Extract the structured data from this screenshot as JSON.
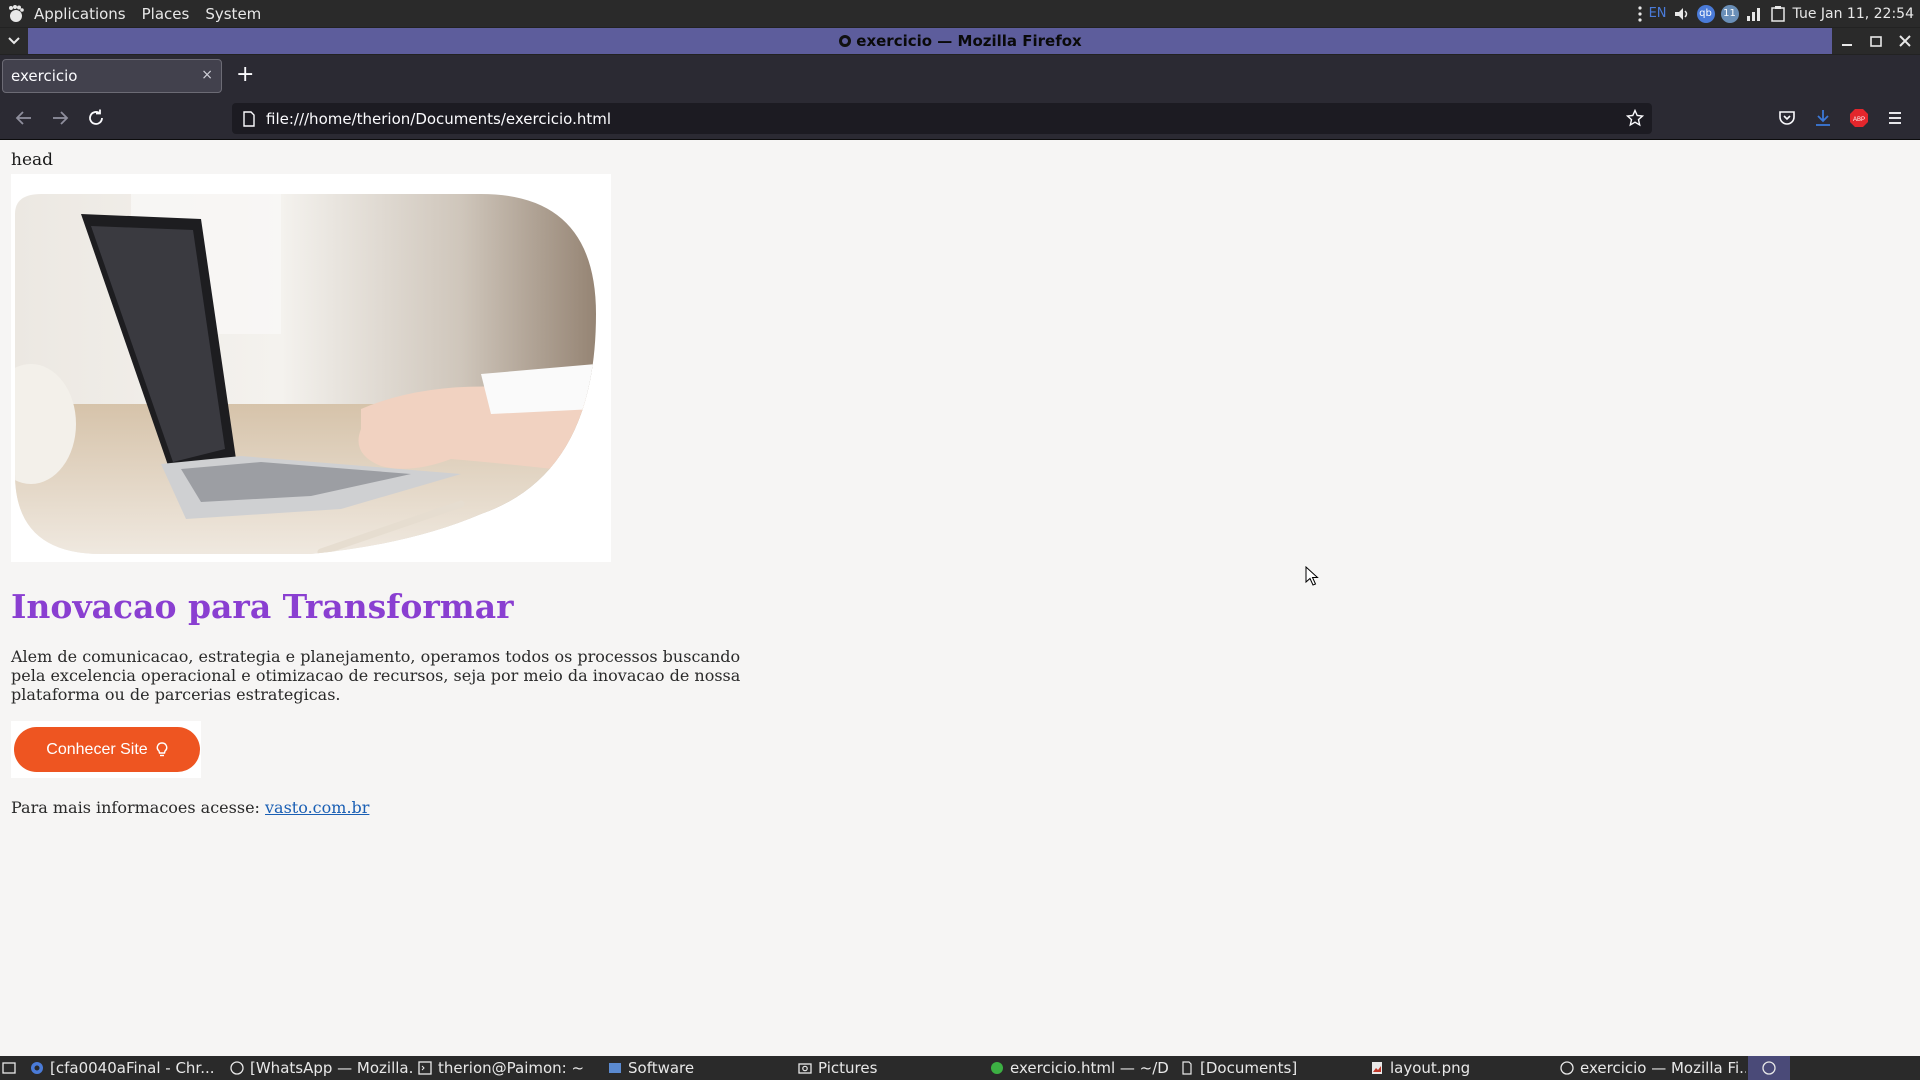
{
  "system_panel": {
    "menus": [
      "Applications",
      "Places",
      "System"
    ],
    "tray_lang": "EN",
    "tray_badge": "11",
    "tray_qb": "qb",
    "clock": "Tue Jan 11, 22:54"
  },
  "window": {
    "title": "exercicio — Mozilla Firefox"
  },
  "browser": {
    "tab_title": "exercicio",
    "tab_close": "×",
    "new_tab": "+",
    "url": "file:///home/therion/Documents/exercicio.html"
  },
  "page": {
    "head_text": "head",
    "heading": "Inovacao para Transformar",
    "description": "Alem de comunicacao, estrategia e planejamento, operamos todos os processos buscando pela excelencia operacional e otimizacao de recursos, seja por meio da inovacao de nossa plataforma ou de parcerias estrategicas.",
    "cta_label": "Conhecer Site",
    "more_prefix": "Para mais informacoes acesse: ",
    "more_link": "vasto.com.br"
  },
  "taskbar": {
    "items": [
      "[cfa0040aFinal - Chr...",
      "[WhatsApp — Mozilla...",
      "therion@Paimon: ~",
      "Software",
      "Pictures",
      "exercicio.html — ~/D...",
      "[Documents]",
      "layout.png",
      "exercicio — Mozilla Fi..."
    ]
  },
  "colors": {
    "heading": "#8a3fd1",
    "cta": "#ee5521",
    "link": "#1a5fb4",
    "titlebar": "#5d5d9c"
  }
}
